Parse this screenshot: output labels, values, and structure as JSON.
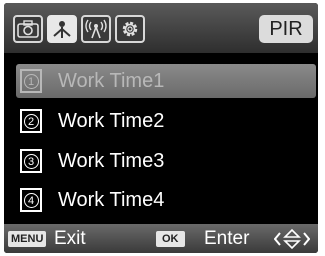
{
  "tabs": [
    {
      "icon": "camera-icon",
      "active": false
    },
    {
      "icon": "tree-icon",
      "active": true
    },
    {
      "icon": "signal-tower-icon",
      "active": false
    },
    {
      "icon": "gear-icon",
      "active": false
    }
  ],
  "pir_label": "PIR",
  "items": [
    {
      "num": "1",
      "label": "Work Time1",
      "selected": true
    },
    {
      "num": "2",
      "label": "Work Time2",
      "selected": false
    },
    {
      "num": "3",
      "label": "Work Time3",
      "selected": false
    },
    {
      "num": "4",
      "label": "Work Time4",
      "selected": false
    }
  ],
  "footer": {
    "menu_key": "MENU",
    "exit_label": "Exit",
    "ok_key": "OK",
    "enter_label": "Enter",
    "nav_icon": "navigate-arrows-icon"
  },
  "colors": {
    "background": "#000000",
    "selected_row": "#7a7a7a",
    "text": "#ffffff"
  }
}
